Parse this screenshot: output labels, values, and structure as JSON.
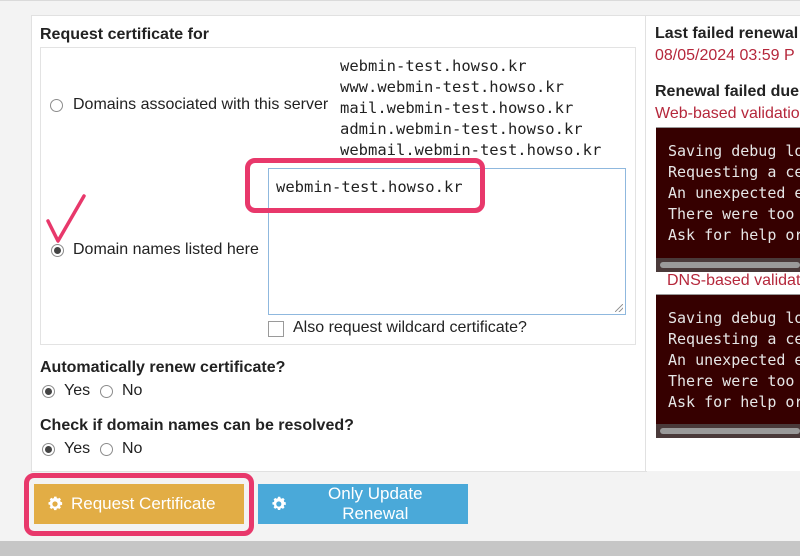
{
  "form": {
    "request_for_heading": "Request certificate for",
    "radio_domains_server_label": "Domains associated with this server",
    "server_domains": [
      "webmin-test.howso.kr",
      "www.webmin-test.howso.kr",
      "mail.webmin-test.howso.kr",
      "admin.webmin-test.howso.kr",
      "webmail.webmin-test.howso.kr"
    ],
    "radio_listed_label": "Domain names listed here",
    "listed_domains_value": "webmin-test.howso.kr",
    "wildcard_label": "Also request wildcard certificate?",
    "auto_renew_heading": "Automatically renew certificate?",
    "auto_renew_yes": "Yes",
    "auto_renew_no": "No",
    "check_resolve_heading": "Check if domain names can be resolved?",
    "check_resolve_yes": "Yes",
    "check_resolve_no": "No"
  },
  "buttons": {
    "request_label": "Request Certificate",
    "update_renewal_label": "Only Update Renewal"
  },
  "sidebar": {
    "last_failed_heading": "Last failed renewal",
    "last_failed_date": "08/05/2024 03:59 P",
    "renewal_failed_heading": "Renewal failed due",
    "web_validation_title": "Web-based validatio",
    "web_log_lines": [
      "Saving debug lo",
      "Requesting a ce",
      "An unexpected e",
      "There were too ",
      "Ask for help or"
    ],
    "dns_validation_title": "DNS-based validati",
    "dns_log_lines": [
      "Saving debug lo",
      "Requesting a ce",
      "An unexpected e",
      "There were too ",
      "Ask for help or"
    ]
  },
  "colors": {
    "highlight": "#e8386b",
    "request_button": "#e2ad45",
    "update_button": "#4aa9d9",
    "log_background": "#360000",
    "error_text": "#b5273b"
  }
}
